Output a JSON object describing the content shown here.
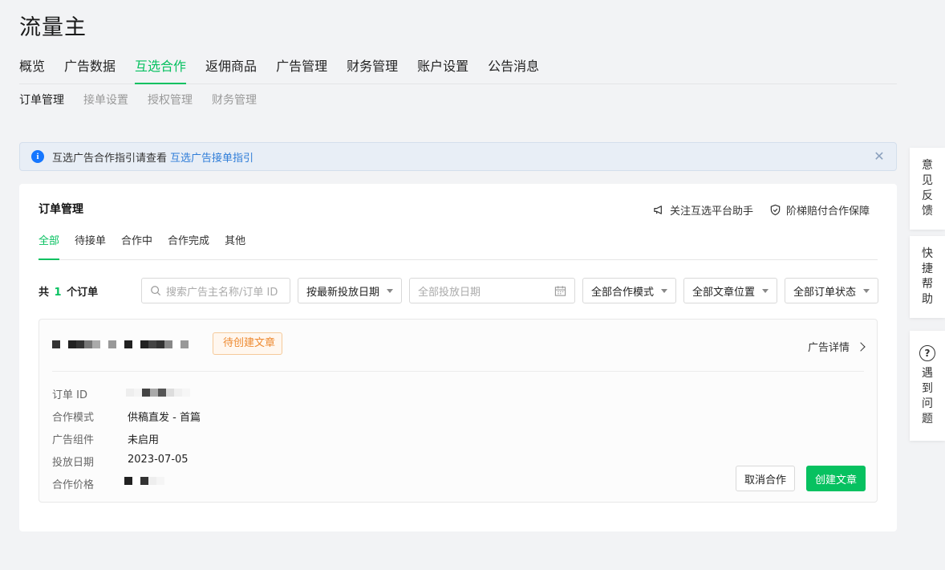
{
  "app": {
    "title": "流量主"
  },
  "main_nav": [
    {
      "label": "概览"
    },
    {
      "label": "广告数据"
    },
    {
      "label": "互选合作",
      "active": true
    },
    {
      "label": "返佣商品"
    },
    {
      "label": "广告管理"
    },
    {
      "label": "财务管理"
    },
    {
      "label": "账户设置"
    },
    {
      "label": "公告消息"
    }
  ],
  "sub_nav": [
    {
      "label": "订单管理",
      "active": true
    },
    {
      "label": "接单设置"
    },
    {
      "label": "授权管理"
    },
    {
      "label": "财务管理"
    }
  ],
  "notice": {
    "text": "互选广告合作指引请查看",
    "link": "互选广告接单指引",
    "icon": "info-icon",
    "close_icon": "close-icon"
  },
  "order_panel": {
    "title": "订单管理",
    "helpers": [
      {
        "label": "关注互选平台助手",
        "icon": "megaphone-icon"
      },
      {
        "label": "阶梯赔付合作保障",
        "icon": "shield-check-icon"
      }
    ],
    "status_tabs": [
      {
        "label": "全部",
        "active": true
      },
      {
        "label": "待接单"
      },
      {
        "label": "合作中"
      },
      {
        "label": "合作完成"
      },
      {
        "label": "其他"
      }
    ],
    "count": {
      "prefix": "共",
      "value": "1",
      "suffix": "个订单"
    },
    "filters": {
      "search_placeholder": "搜索广告主名称/订单 ID",
      "sort": "按最新投放日期",
      "date_placeholder": "全部投放日期",
      "mode": "全部合作模式",
      "position": "全部文章位置",
      "status": "全部订单状态"
    }
  },
  "order": {
    "badge": "待创建文章",
    "detail_link": "广告详情",
    "fields": [
      {
        "label": "订单 ID",
        "value": ""
      },
      {
        "label": "合作模式",
        "value": "供稿直发 - 首篇"
      },
      {
        "label": "广告组件",
        "value": "未启用"
      },
      {
        "label": "投放日期",
        "value": "2023-07-05"
      },
      {
        "label": "合作价格",
        "value": ""
      }
    ],
    "actions": {
      "cancel": "取消合作",
      "create": "创建文章"
    }
  },
  "side_float": {
    "feedback": [
      "意",
      "见",
      "反",
      "馈"
    ],
    "shortcut_help": [
      "快",
      "捷",
      "帮",
      "助"
    ],
    "problem": [
      "遇",
      "到",
      "问",
      "题"
    ],
    "problem_icon": "question-circle-icon"
  },
  "colors": {
    "accent": "#07c160",
    "link": "#2f7dd8",
    "badge_text": "#ee8a30",
    "info": "#1677ff"
  }
}
